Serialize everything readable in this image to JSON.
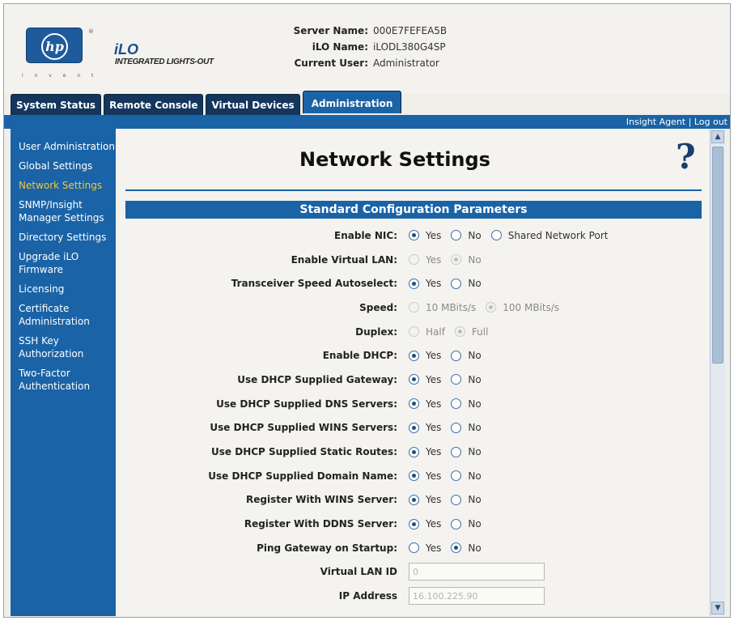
{
  "header": {
    "logo_text": "hp",
    "logo_subtitle": "i n v e n t",
    "reg_mark": "®",
    "product_title": "iLO",
    "product_subtitle": "INTEGRATED LIGHTS-OUT",
    "server_name_label": "Server Name:",
    "server_name_value": "000E7FEFEA5B",
    "ilo_name_label": "iLO Name:",
    "ilo_name_value": "iLODL380G4SP",
    "current_user_label": "Current User:",
    "current_user_value": "Administrator"
  },
  "tabs": [
    {
      "label": "System Status",
      "active": false
    },
    {
      "label": "Remote Console",
      "active": false
    },
    {
      "label": "Virtual Devices",
      "active": false
    },
    {
      "label": "Administration",
      "active": true
    }
  ],
  "top_links": {
    "insight_agent": "Insight Agent",
    "separator": "|",
    "logout": "Log out"
  },
  "sidebar": {
    "items": [
      {
        "label": "User Administration",
        "active": false
      },
      {
        "label": "Global Settings",
        "active": false
      },
      {
        "label": "Network Settings",
        "active": true
      },
      {
        "label": "SNMP/Insight Manager Settings",
        "active": false
      },
      {
        "label": "Directory Settings",
        "active": false
      },
      {
        "label": "Upgrade iLO Firmware",
        "active": false
      },
      {
        "label": "Licensing",
        "active": false
      },
      {
        "label": "Certificate Administration",
        "active": false
      },
      {
        "label": "SSH Key Authorization",
        "active": false
      },
      {
        "label": "Two-Factor Authentication",
        "active": false
      }
    ]
  },
  "main": {
    "title": "Network Settings",
    "help_symbol": "?",
    "section_title": "Standard Configuration Parameters",
    "rows": [
      {
        "label": "Enable NIC:",
        "options": [
          {
            "label": "Yes",
            "checked": true
          },
          {
            "label": "No",
            "checked": false
          },
          {
            "label": "Shared Network Port",
            "checked": false
          }
        ]
      },
      {
        "label": "Enable Virtual LAN:",
        "disabled": true,
        "options": [
          {
            "label": "Yes",
            "checked": false
          },
          {
            "label": "No",
            "checked": true
          }
        ]
      },
      {
        "label": "Transceiver Speed Autoselect:",
        "options": [
          {
            "label": "Yes",
            "checked": true
          },
          {
            "label": "No",
            "checked": false
          }
        ]
      },
      {
        "label": "Speed:",
        "disabled": true,
        "options": [
          {
            "label": "10 MBits/s",
            "checked": false
          },
          {
            "label": "100 MBits/s",
            "checked": true
          }
        ]
      },
      {
        "label": "Duplex:",
        "disabled": true,
        "options": [
          {
            "label": "Half",
            "checked": false
          },
          {
            "label": "Full",
            "checked": true
          }
        ]
      },
      {
        "label": "Enable DHCP:",
        "options": [
          {
            "label": "Yes",
            "checked": true
          },
          {
            "label": "No",
            "checked": false
          }
        ]
      },
      {
        "label": "Use DHCP Supplied Gateway:",
        "options": [
          {
            "label": "Yes",
            "checked": true
          },
          {
            "label": "No",
            "checked": false
          }
        ]
      },
      {
        "label": "Use DHCP Supplied DNS Servers:",
        "options": [
          {
            "label": "Yes",
            "checked": true
          },
          {
            "label": "No",
            "checked": false
          }
        ]
      },
      {
        "label": "Use DHCP Supplied WINS Servers:",
        "options": [
          {
            "label": "Yes",
            "checked": true
          },
          {
            "label": "No",
            "checked": false
          }
        ]
      },
      {
        "label": "Use DHCP Supplied Static Routes:",
        "options": [
          {
            "label": "Yes",
            "checked": true
          },
          {
            "label": "No",
            "checked": false
          }
        ]
      },
      {
        "label": "Use DHCP Supplied Domain Name:",
        "options": [
          {
            "label": "Yes",
            "checked": true
          },
          {
            "label": "No",
            "checked": false
          }
        ]
      },
      {
        "label": "Register With WINS Server:",
        "options": [
          {
            "label": "Yes",
            "checked": true
          },
          {
            "label": "No",
            "checked": false
          }
        ]
      },
      {
        "label": "Register With DDNS Server:",
        "options": [
          {
            "label": "Yes",
            "checked": true
          },
          {
            "label": "No",
            "checked": false
          }
        ]
      },
      {
        "label": "Ping Gateway on Startup:",
        "options": [
          {
            "label": "Yes",
            "checked": false
          },
          {
            "label": "No",
            "checked": true
          }
        ]
      },
      {
        "label": "Virtual LAN ID",
        "input": "0"
      },
      {
        "label": "IP Address",
        "input": "16.100.225.90"
      }
    ]
  },
  "colors": {
    "nav_blue": "#1a63a6",
    "tab_dark": "#15365c",
    "active_nav_text": "#f5c63a"
  }
}
